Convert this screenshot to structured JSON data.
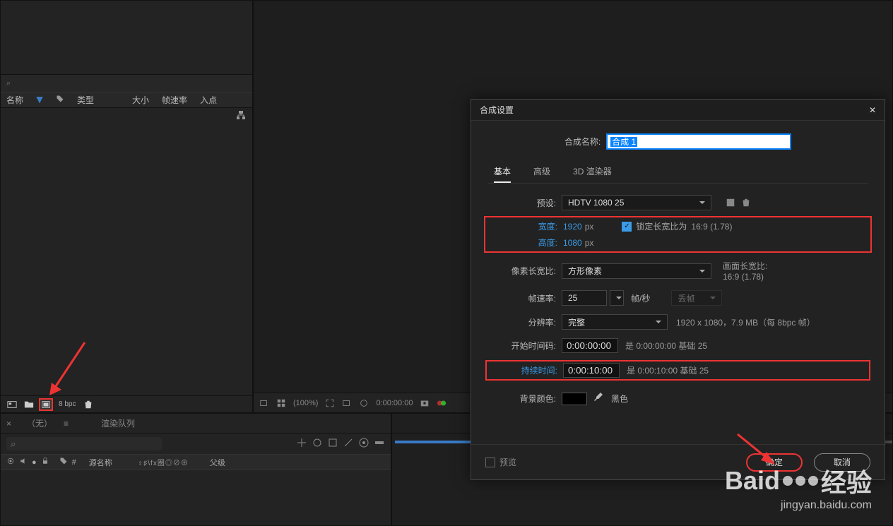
{
  "project": {
    "search_placeholder": "⌕",
    "cols": {
      "name": "名称",
      "type": "类型",
      "size": "大小",
      "fps": "帧速率",
      "in": "入点"
    },
    "footer": {
      "bpc": "8 bpc"
    }
  },
  "viewer": {
    "zoom": "(100%)",
    "time": "0:00:00:00"
  },
  "timeline": {
    "tab1": "（无）",
    "tab2": "渲染队列",
    "search_placeholder": "⌕",
    "head": {
      "num": "#",
      "src": "源名称",
      "switches": "♀♯\\fx圈◎⊘⊕",
      "parent": "父级"
    }
  },
  "dialog": {
    "title": "合成设置",
    "name_lbl": "合成名称:",
    "name_val": "合成 1",
    "tabs": {
      "basic": "基本",
      "adv": "高级",
      "r3d": "3D 渲染器"
    },
    "preset_lbl": "预设:",
    "preset_val": "HDTV 1080 25",
    "width_lbl": "宽度:",
    "width_val": "1920",
    "px": "px",
    "height_lbl": "高度:",
    "height_val": "1080",
    "lock_lbl": "锁定长宽比为",
    "lock_ratio": "16:9 (1.78)",
    "par_lbl": "像素长宽比:",
    "par_val": "方形像素",
    "frame_aspect_lbl": "画面长宽比:",
    "frame_aspect_val": "16:9 (1.78)",
    "fps_lbl": "帧速率:",
    "fps_val": "25",
    "fps_unit": "帧/秒",
    "drop": "丢帧",
    "res_lbl": "分辨率:",
    "res_val": "完整",
    "res_info": "1920 x 1080，7.9 MB（每 8bpc 帧）",
    "start_lbl": "开始时间码:",
    "start_val": "0:00:00:00",
    "start_info": "是 0:00:00:00 基础 25",
    "dur_lbl": "持续时间:",
    "dur_val": "0:00:10:00",
    "dur_info": "是 0:00:10:00 基础 25",
    "bg_lbl": "背景颜色:",
    "bg_name": "黑色",
    "preview": "预览",
    "ok": "确定",
    "cancel": "取消"
  },
  "watermark": {
    "brand": "Baid",
    "sub": "经验",
    "url": "jingyan.baidu.com"
  }
}
